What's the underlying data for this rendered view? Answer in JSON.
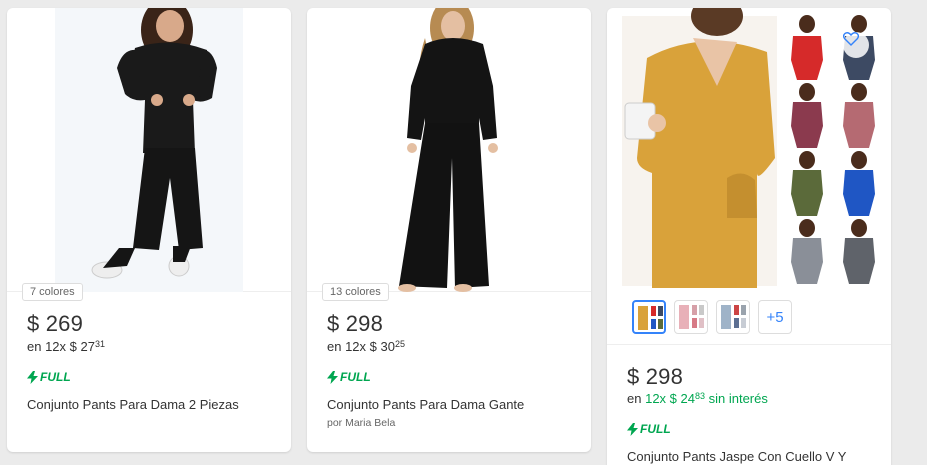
{
  "products": [
    {
      "colors_badge": "7 colores",
      "price": "$ 269",
      "installments_prefix": "en 12x $ 27",
      "installments_cents": "31",
      "shipping": "FULL",
      "title": "Conjunto Pants Para Dama 2 Piezas"
    },
    {
      "colors_badge": "13 colores",
      "price": "$ 298",
      "installments_prefix": "en 12x $ 30",
      "installments_cents": "25",
      "shipping": "FULL",
      "title": "Conjunto Pants Para Dama Gante",
      "seller": "por Maria Bela"
    },
    {
      "price": "$ 298",
      "installments_en": "en",
      "installments_prefix": "12x $ 24",
      "installments_cents": "83",
      "installments_suffix": "sin interés",
      "shipping": "FULL",
      "title": "Conjunto Pants Jaspe Con Cuello V Y",
      "thumbs_more": "+5"
    }
  ],
  "colors": {
    "full_green": "#00a650",
    "accent_blue": "#3483fa",
    "mustard": "#d9a23a",
    "black_outfit": "#1a1a1a"
  }
}
